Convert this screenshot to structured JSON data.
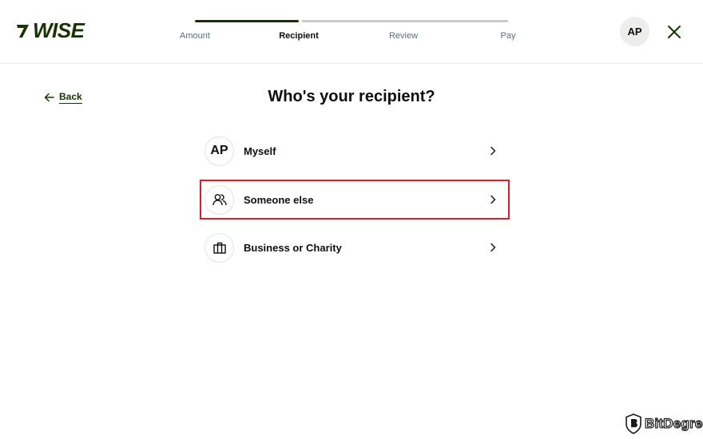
{
  "brand": {
    "logo_text": "WISE",
    "color": "#163300"
  },
  "stepper": {
    "steps": [
      {
        "label": "Amount",
        "state": "done"
      },
      {
        "label": "Recipient",
        "state": "current"
      },
      {
        "label": "Review",
        "state": "upcoming"
      },
      {
        "label": "Pay",
        "state": "upcoming"
      }
    ]
  },
  "header": {
    "avatar_initials": "AP",
    "close_icon": "close-icon"
  },
  "back": {
    "label": "Back",
    "icon": "arrow-left-icon"
  },
  "page": {
    "title": "Who's your recipient?"
  },
  "options": [
    {
      "label": "Myself",
      "icon_text": "AP",
      "icon": "initials-avatar"
    },
    {
      "label": "Someone else",
      "icon": "people-icon",
      "highlighted": true
    },
    {
      "label": "Business or Charity",
      "icon": "briefcase-icon"
    }
  ],
  "highlight_color": "#e01b24",
  "watermark": {
    "text": "BitDegree"
  }
}
